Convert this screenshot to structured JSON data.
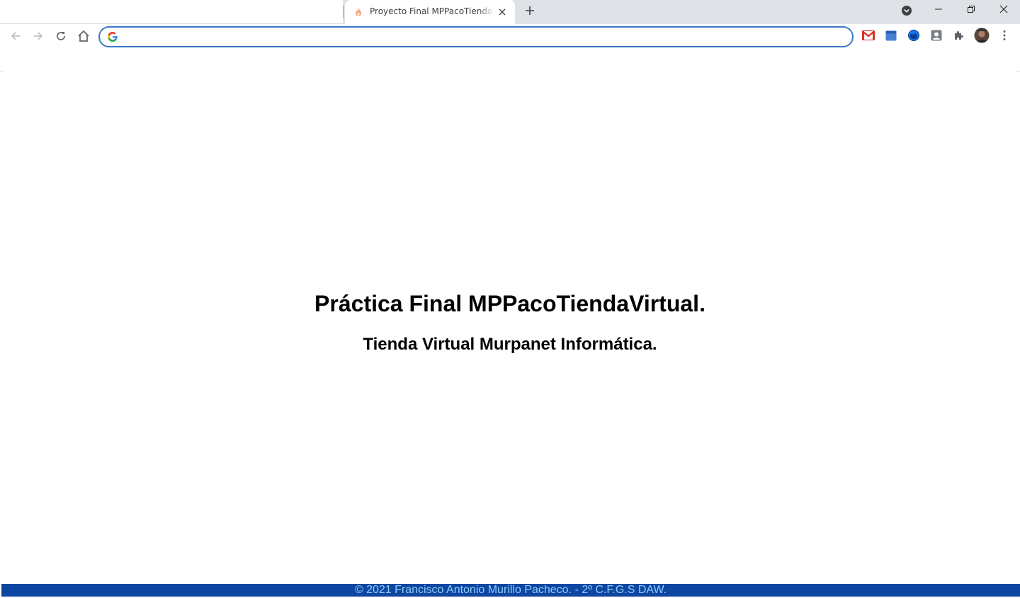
{
  "window": {
    "tab": {
      "title": "Proyecto Final MPPacoTiendaVirtual",
      "favicon": "flame-favicon-icon"
    },
    "controls": {
      "new_tab": "plus-icon",
      "tab_search": "tab-search-icon",
      "minimize": "minimize-icon",
      "restore": "restore-icon",
      "close": "close-icon"
    }
  },
  "toolbar": {
    "nav": [
      "back-arrow-icon",
      "forward-arrow-icon",
      "reload-icon",
      "home-icon"
    ],
    "omnibox": {
      "value": "",
      "placeholder": ""
    },
    "extensions": [
      "gmail-icon",
      "calendar-icon",
      "globe-extension-icon",
      "contact-card-icon",
      "extensions-puzzle-icon",
      "profile-avatar",
      "more-menu-icon"
    ]
  },
  "page": {
    "title": "Práctica Final MPPacoTiendaVirtual.",
    "subtitle": "Tienda Virtual Murpanet Informática.",
    "footer": "© 2021 Francisco Antonio Murillo Pacheco. - 2º C.F.G.S DAW."
  },
  "colors": {
    "omnibox_focus_border": "#3b78c3",
    "footer_background": "#0d47a1",
    "footer_text": "#90caf9",
    "tabstrip_background": "#dee1e6"
  }
}
